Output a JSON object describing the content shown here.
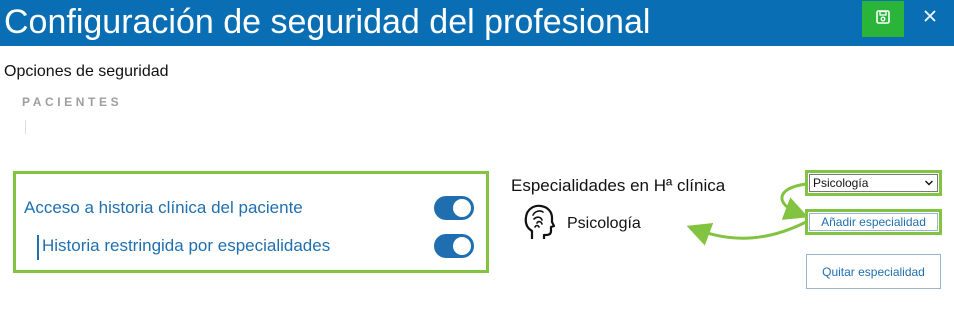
{
  "window": {
    "title": "Configuración de seguridad del profesional",
    "save_icon": "save-icon",
    "close_icon": "close-icon",
    "title_bar_color": "#0a6eb4",
    "save_button_color": "#2ab43a"
  },
  "section": {
    "title": "Opciones de seguridad",
    "group_label": "PACIENTES"
  },
  "permissions": [
    {
      "label": "Acceso a historia clínica del paciente",
      "enabled": true
    },
    {
      "label": "Historia restringida por especialidades",
      "enabled": true
    }
  ],
  "specialties": {
    "title": "Especialidades en Hª clínica",
    "items": [
      {
        "label": "Psicología",
        "icon": "head-profile-icon"
      }
    ],
    "select_value": "Psicología",
    "add_label": "Añadir especialidad",
    "remove_label": "Quitar especialidad"
  },
  "colors": {
    "accent": "#1f6fb0",
    "highlight": "#82c341"
  }
}
